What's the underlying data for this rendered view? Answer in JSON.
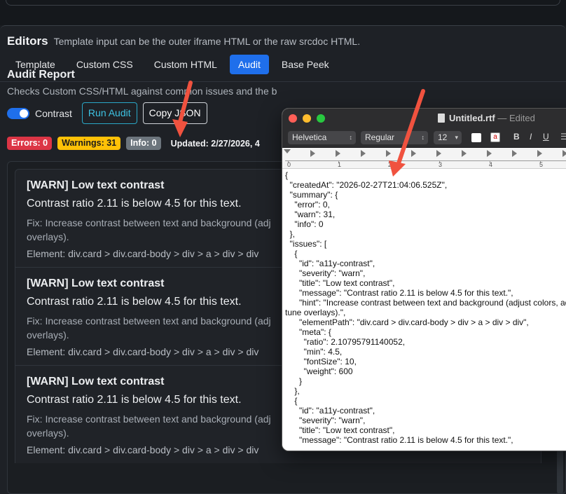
{
  "editors": {
    "title": "Editors",
    "subtitle": "Template input can be the outer iframe HTML or the raw srcdoc HTML."
  },
  "tabs": [
    {
      "label": "Template",
      "active": false
    },
    {
      "label": "Custom CSS",
      "active": false
    },
    {
      "label": "Custom HTML",
      "active": false
    },
    {
      "label": "Audit",
      "active": true
    },
    {
      "label": "Base Peek",
      "active": false
    }
  ],
  "audit": {
    "title": "Audit Report",
    "subtitle": "Checks Custom CSS/HTML against common issues and the b",
    "contrast_label": "Contrast",
    "contrast_enabled": true,
    "run_label": "Run Audit",
    "copy_label": "Copy JSON",
    "badges": {
      "errors": "Errors: 0",
      "warnings": "Warnings: 31",
      "info": "Info: 0"
    },
    "updated": "Updated: 2/27/2026, 4"
  },
  "issues": [
    {
      "title": "[WARN] Low text contrast",
      "message": "Contrast ratio 2.11 is below 4.5 for this text.",
      "fix_line1": "Fix: Increase contrast between text and background (adj",
      "fix_line2": "overlays).",
      "element": "Element: div.card > div.card-body > div > a > div > div"
    },
    {
      "title": "[WARN] Low text contrast",
      "message": "Contrast ratio 2.11 is below 4.5 for this text.",
      "fix_line1": "Fix: Increase contrast between text and background (adj",
      "fix_line2": "overlays).",
      "element": "Element: div.card > div.card-body > div > a > div > div"
    },
    {
      "title": "[WARN] Low text contrast",
      "message": "Contrast ratio 2.11 is below 4.5 for this text.",
      "fix_line1": "Fix: Increase contrast between text and background (adj",
      "fix_line2": "overlays).",
      "element": "Element: div.card > div.card-body > div > a > div > div"
    }
  ],
  "textedit": {
    "filename": "Untitled.rtf",
    "separator": "—",
    "status": "Edited",
    "font": "Helvetica",
    "style": "Regular",
    "size": "12",
    "bold": "B",
    "italic": "I",
    "underline": "U",
    "ruler_numbers": [
      "0",
      "1",
      "2",
      "3",
      "4",
      "5"
    ],
    "content": "{\n  \"createdAt\": \"2026-02-27T21:04:06.525Z\",\n  \"summary\": {\n    \"error\": 0,\n    \"warn\": 31,\n    \"info\": 0\n  },\n  \"issues\": [\n    {\n      \"id\": \"a11y-contrast\",\n      \"severity\": \"warn\",\n      \"title\": \"Low text contrast\",\n      \"message\": \"Contrast ratio 2.11 is below 4.5 for this text.\",\n      \"hint\": \"Increase contrast between text and background (adjust colors, ad\ntune overlays).\",\n      \"elementPath\": \"div.card > div.card-body > div > a > div > div\",\n      \"meta\": {\n        \"ratio\": 2.10795791140052,\n        \"min\": 4.5,\n        \"fontSize\": 10,\n        \"weight\": 600\n      }\n    },\n    {\n      \"id\": \"a11y-contrast\",\n      \"severity\": \"warn\",\n      \"title\": \"Low text contrast\",\n      \"message\": \"Contrast ratio 2.11 is below 4.5 for this text.\","
  },
  "colors": {
    "accent": "#1f6feb",
    "audit_button": "#3ec3e3",
    "error": "#dc3545",
    "warning": "#ffc107",
    "info": "#6c757d",
    "arrow": "#f0523f"
  }
}
